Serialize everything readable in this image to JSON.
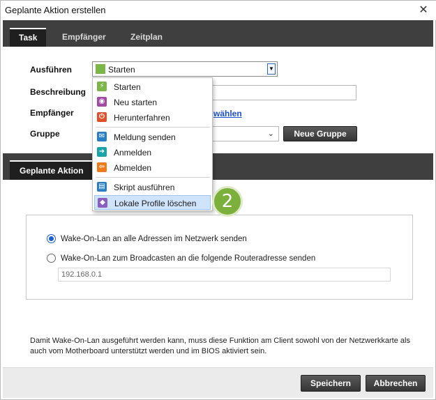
{
  "window": {
    "title": "Geplante Aktion erstellen",
    "close_glyph": "✕"
  },
  "tabs": [
    {
      "label": "Task",
      "active": true
    },
    {
      "label": "Empfänger",
      "active": false
    },
    {
      "label": "Zeitplan",
      "active": false
    }
  ],
  "form": {
    "execute_label": "Ausführen",
    "execute_value": "Starten",
    "execute_icon": "bolt-icon",
    "description_label": "Beschreibung",
    "recipients_label": "Empfänger",
    "recipients_link": "wählen",
    "group_label": "Gruppe",
    "new_group_button": "Neue Gruppe"
  },
  "dropdown": {
    "items": [
      {
        "label": "Starten",
        "icon": "bolt-icon",
        "color": "#7ab648",
        "glyph": "⚡"
      },
      {
        "label": "Neu starten",
        "icon": "restart-icon",
        "color": "#a24aa4",
        "glyph": "◉"
      },
      {
        "label": "Herunterfahren",
        "icon": "power-icon",
        "color": "#e0512b",
        "glyph": "⏻"
      },
      {
        "label": "Meldung senden",
        "icon": "message-icon",
        "color": "#2a7fc4",
        "glyph": "✉"
      },
      {
        "label": "Anmelden",
        "icon": "login-icon",
        "color": "#1aa3a8",
        "glyph": "➜"
      },
      {
        "label": "Abmelden",
        "icon": "logout-icon",
        "color": "#ef7a1a",
        "glyph": "⇦"
      },
      {
        "label": "Skript ausführen",
        "icon": "script-icon",
        "color": "#2a7fc4",
        "glyph": "▤"
      },
      {
        "label": "Lokale Profile löschen",
        "icon": "eraser-icon",
        "color": "#8a5fc0",
        "glyph": "◆"
      }
    ],
    "highlighted_index": 7
  },
  "step_badge": "2",
  "section": {
    "tab_label": "Geplante Aktion"
  },
  "wol": {
    "option1": "Wake-On-Lan an alle Adressen im Netzwerk senden",
    "option1_checked": true,
    "option2": "Wake-On-Lan zum Broadcasten an die folgende Routeradresse senden",
    "option2_checked": false,
    "router_address": "192.168.0.1"
  },
  "note": "Damit Wake-On-Lan ausgeführt werden kann, muss diese Funktion am Client sowohl von der Netzwerkkarte als auch vom Motherboard unterstützt werden und im BIOS aktiviert sein.",
  "footer": {
    "save": "Speichern",
    "cancel": "Abbrechen"
  }
}
